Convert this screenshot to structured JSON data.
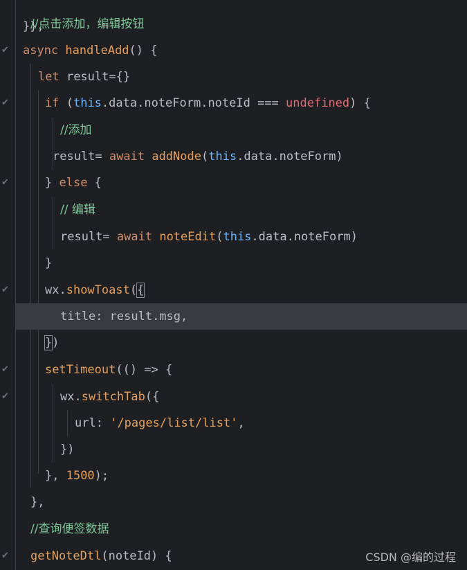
{
  "editor": {
    "top_fragment": "}},",
    "lines": [
      {
        "parts": [
          {
            "t": "//点击添加，编辑按钮",
            "c": "comment"
          }
        ]
      },
      {
        "parts": [
          {
            "t": "async ",
            "c": "kw"
          },
          {
            "t": "handleAdd",
            "c": "fn"
          },
          {
            "t": "() {",
            "c": "punct"
          }
        ]
      },
      {
        "parts": [
          {
            "t": "let ",
            "c": "kw"
          },
          {
            "t": "result",
            "c": "prop"
          },
          {
            "t": "={}",
            "c": "punct"
          }
        ]
      },
      {
        "parts": [
          {
            "t": "if ",
            "c": "kw"
          },
          {
            "t": "(",
            "c": "punct"
          },
          {
            "t": "this",
            "c": "this"
          },
          {
            "t": ".data.noteForm.noteId === ",
            "c": "prop"
          },
          {
            "t": "undefined",
            "c": "undef"
          },
          {
            "t": ") {",
            "c": "punct"
          }
        ]
      },
      {
        "parts": [
          {
            "t": "//添加",
            "c": "comment"
          }
        ]
      },
      {
        "parts": [
          {
            "t": "result",
            "c": "prop"
          },
          {
            "t": "= ",
            "c": "punct"
          },
          {
            "t": "await ",
            "c": "kw"
          },
          {
            "t": "addNode",
            "c": "fn"
          },
          {
            "t": "(",
            "c": "punct"
          },
          {
            "t": "this",
            "c": "this"
          },
          {
            "t": ".data.noteForm)",
            "c": "prop"
          }
        ]
      },
      {
        "parts": [
          {
            "t": "} ",
            "c": "punct"
          },
          {
            "t": "else ",
            "c": "kw"
          },
          {
            "t": "{",
            "c": "punct"
          }
        ]
      },
      {
        "parts": [
          {
            "t": "// 编辑",
            "c": "comment"
          }
        ]
      },
      {
        "parts": [
          {
            "t": "result",
            "c": "prop"
          },
          {
            "t": "= ",
            "c": "punct"
          },
          {
            "t": "await ",
            "c": "kw"
          },
          {
            "t": "noteEdit",
            "c": "fn"
          },
          {
            "t": "(",
            "c": "punct"
          },
          {
            "t": "this",
            "c": "this"
          },
          {
            "t": ".data.noteForm)",
            "c": "prop"
          }
        ]
      },
      {
        "parts": [
          {
            "t": "}",
            "c": "punct"
          }
        ]
      },
      {
        "parts": [
          {
            "t": "wx.",
            "c": "prop"
          },
          {
            "t": "showToast",
            "c": "fn"
          },
          {
            "t": "(",
            "c": "punct"
          },
          {
            "t": "{",
            "c": "punct brace-hl"
          }
        ]
      },
      {
        "parts": [
          {
            "t": "title",
            "c": "prop"
          },
          {
            "t": ": result.msg,",
            "c": "prop"
          }
        ]
      },
      {
        "parts": [
          {
            "t": "}",
            "c": "punct brace-hl"
          },
          {
            "t": ")",
            "c": "punct"
          }
        ]
      },
      {
        "parts": [
          {
            "t": "setTimeout",
            "c": "fn"
          },
          {
            "t": "(() => {",
            "c": "punct"
          }
        ]
      },
      {
        "parts": [
          {
            "t": "wx.",
            "c": "prop"
          },
          {
            "t": "switchTab",
            "c": "fn"
          },
          {
            "t": "({",
            "c": "punct"
          }
        ]
      },
      {
        "parts": [
          {
            "t": "url",
            "c": "prop"
          },
          {
            "t": ": ",
            "c": "punct"
          },
          {
            "t": "'/pages/list/list'",
            "c": "str"
          },
          {
            "t": ",",
            "c": "punct"
          }
        ]
      },
      {
        "parts": [
          {
            "t": "})",
            "c": "punct"
          }
        ]
      },
      {
        "parts": [
          {
            "t": "}, ",
            "c": "punct"
          },
          {
            "t": "1500",
            "c": "num"
          },
          {
            "t": ");",
            "c": "punct"
          }
        ]
      },
      {
        "parts": [
          {
            "t": "},",
            "c": "punct"
          }
        ]
      },
      {
        "parts": [
          {
            "t": "//查询便签数据",
            "c": "comment"
          }
        ]
      },
      {
        "parts": [
          {
            "t": "getNoteDtl",
            "c": "fn"
          },
          {
            "t": "(noteId) {",
            "c": "punct"
          }
        ]
      }
    ]
  },
  "watermark": "CSDN @编的过程"
}
